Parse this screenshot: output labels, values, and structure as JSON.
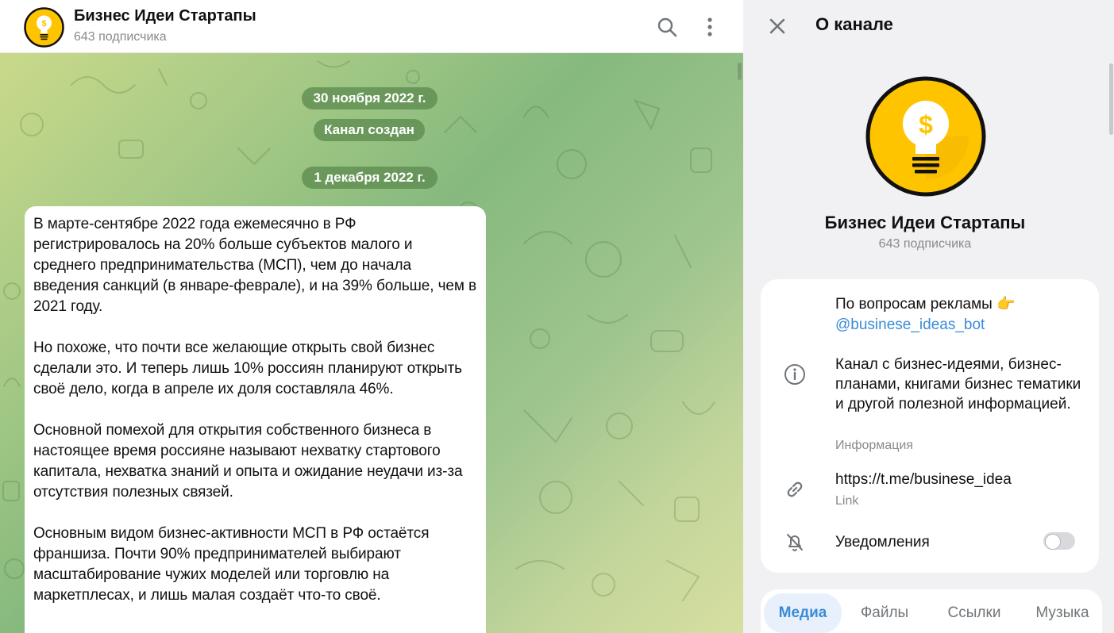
{
  "chat": {
    "title": "Бизнес Идеи Стартапы",
    "subscribers": "643 подписчика",
    "search_icon": "search-icon",
    "more_icon": "more-vertical-icon"
  },
  "timeline": {
    "date1": "30 ноября 2022 г.",
    "service": "Канал создан",
    "date2": "1 декабря 2022 г."
  },
  "message": {
    "paragraphs": [
      "В марте-сентябре 2022 года ежемесячно в РФ регистрировалось на 20% больше субъектов малого и среднего предпринимательства (МСП), чем до начала введения санкций (в январе-феврале), и на 39% больше, чем в 2021 году.",
      "Но похоже, что почти все желающие открыть свой бизнес сделали это. И теперь лишь 10% россиян планируют открыть своё дело, когда в апреле их доля составляла 46%.",
      "Основной помехой для открытия собственного бизнеса в настоящее время россияне называют нехватку стартового капитала, нехватка знаний и опыта и ожидание неудачи из-за отсутствия полезных связей.",
      "Основным видом бизнес-активности МСП в РФ остаётся франшиза. Почти 90% предпринимателей выбирают масштабирование чужих моделей или торговлю на маркетплесах, и лишь малая создаёт что-то своё."
    ]
  },
  "info": {
    "header": "О канале",
    "close_icon": "close-icon",
    "name": "Бизнес Идеи Стартапы",
    "subscribers": "643 подписчика",
    "ads_line": "По вопросам рекламы 👉",
    "ads_link": "@businese_ideas_bot",
    "description": "Канал с бизнес-идеями, бизнес-планами, книгами бизнес тематики и другой полезной информацией.",
    "description_caption": "Информация",
    "link": "https://t.me/businese_idea",
    "link_caption": "Link",
    "notifications": "Уведомления",
    "notifications_on": false,
    "tabs": [
      "Медиа",
      "Файлы",
      "Ссылки",
      "Музыка"
    ],
    "active_tab": "Медиа"
  },
  "colors": {
    "accent": "#3a8bd6",
    "avatar_yellow": "#ffc400",
    "date_pill": "#5e8c50"
  }
}
